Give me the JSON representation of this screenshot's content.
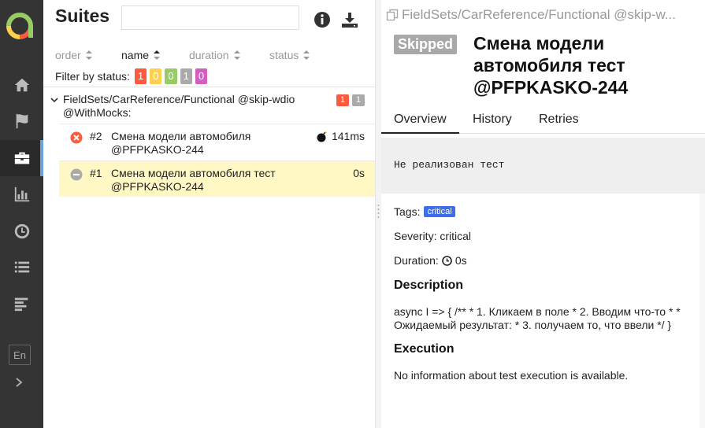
{
  "sidebar": {
    "lang_label": "En",
    "items": [
      {
        "icon": "home-icon",
        "active": false
      },
      {
        "icon": "flag-icon",
        "active": false
      },
      {
        "icon": "briefcase-icon",
        "active": true
      },
      {
        "icon": "bar-chart-icon",
        "active": false
      },
      {
        "icon": "clock-icon",
        "active": false
      },
      {
        "icon": "list-icon",
        "active": false
      },
      {
        "icon": "timeline-icon",
        "active": false
      }
    ]
  },
  "suites": {
    "title": "Suites",
    "search": {
      "value": "",
      "placeholder": ""
    },
    "sort": {
      "order_label": "order",
      "name_label": "name",
      "duration_label": "duration",
      "status_label": "status"
    },
    "filter": {
      "label": "Filter by status:",
      "badges": [
        {
          "count": "1",
          "color": "#fd5a3e"
        },
        {
          "count": "0",
          "color": "#ffd050"
        },
        {
          "count": "0",
          "color": "#97cc64"
        },
        {
          "count": "1",
          "color": "#aaaaaa"
        },
        {
          "count": "0",
          "color": "#d35ebe"
        }
      ]
    },
    "group": {
      "name": "FieldSets/CarReference/Functional @skip-wdio @WithMocks:",
      "badges": [
        {
          "count": "1",
          "color": "#fd5a3e"
        },
        {
          "count": "1",
          "color": "#aaaaaa"
        }
      ]
    },
    "tests": [
      {
        "num": "#2",
        "name": "Смена модели автомобиля @PFPKASKO-244",
        "duration": "141ms",
        "status": "broken"
      },
      {
        "num": "#1",
        "name": "Смена модели автомобиля тест @PFPKASKO-244",
        "duration": "0s",
        "status": "skipped"
      }
    ]
  },
  "detail": {
    "breadcrumb": "FieldSets/CarReference/Functional @skip-w...",
    "status": "Skipped",
    "title": "Смена модели автомобиля тест @PFPKASKO-244",
    "tabs": {
      "overview": "Overview",
      "history": "History",
      "retries": "Retries"
    },
    "message": "Не реализован тест",
    "tags_label": "Tags:",
    "tag": "critical",
    "severity_label": "Severity:",
    "severity_value": "critical",
    "duration_label": "Duration:",
    "duration_value": "0s",
    "description_heading": "Description",
    "description_text": "async I => { /** * 1. Кликаем в поле * 2. Вводим что-то * * Ожидаемый результат: * 3. получаем то, что ввели */ }",
    "execution_heading": "Execution",
    "execution_text": "No information about test execution is available."
  }
}
